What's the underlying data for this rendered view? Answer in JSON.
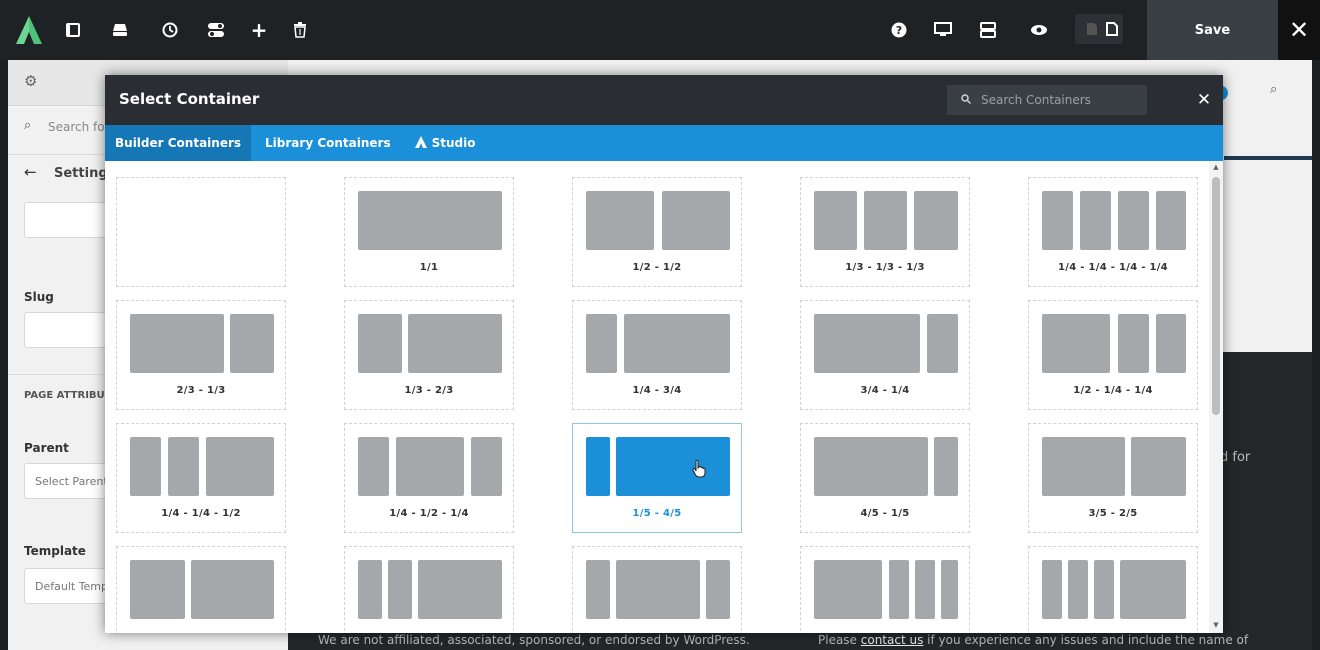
{
  "toolbar": {
    "save_label": "Save",
    "close_icon": "close-icon"
  },
  "left_panel": {
    "search_placeholder": "Search for",
    "settings_label": "Setting",
    "slug_label": "Slug",
    "page_attributes_label": "PAGE ATTRIBU",
    "parent_label": "Parent",
    "parent_value": "Select Parent",
    "template_label": "Template",
    "template_value": "Default Temp"
  },
  "right_panel": {
    "side_text": "d for"
  },
  "footer": {
    "disclaimer": "We are not affiliated, associated, sponsored, or endorsed by WordPress.",
    "contact_prefix": "Please ",
    "contact_link": "contact us",
    "contact_suffix": " if you experience any issues and include the name of"
  },
  "modal": {
    "title": "Select Container",
    "search_placeholder": "Search Containers",
    "tabs": [
      {
        "label": "Builder Containers",
        "active": true
      },
      {
        "label": "Library Containers",
        "active": false
      },
      {
        "label": "Studio",
        "active": false
      }
    ],
    "containers": [
      {
        "label": "",
        "selected": false
      },
      {
        "label": "1/1",
        "selected": false
      },
      {
        "label": "1/2 - 1/2",
        "selected": false
      },
      {
        "label": "1/3 - 1/3 - 1/3",
        "selected": false
      },
      {
        "label": "1/4 - 1/4 - 1/4 - 1/4",
        "selected": false
      },
      {
        "label": "2/3 - 1/3",
        "selected": false
      },
      {
        "label": "1/3 - 2/3",
        "selected": false
      },
      {
        "label": "1/4 - 3/4",
        "selected": false
      },
      {
        "label": "3/4 - 1/4",
        "selected": false
      },
      {
        "label": "1/2 - 1/4 - 1/4",
        "selected": false
      },
      {
        "label": "1/4 - 1/4 - 1/2",
        "selected": false
      },
      {
        "label": "1/4 - 1/2 - 1/4",
        "selected": false
      },
      {
        "label": "1/5 - 4/5",
        "selected": true
      },
      {
        "label": "4/5 - 1/5",
        "selected": false
      },
      {
        "label": "3/5 - 2/5",
        "selected": false
      },
      {
        "label": "",
        "selected": false
      },
      {
        "label": "",
        "selected": false
      },
      {
        "label": "",
        "selected": false
      },
      {
        "label": "",
        "selected": false
      },
      {
        "label": "",
        "selected": false
      }
    ]
  },
  "colors": {
    "accent": "#1b90d8",
    "toolbar_bg": "#1f2225",
    "block_gray": "#a5a8ab",
    "brand_green": "#4ec27a"
  }
}
